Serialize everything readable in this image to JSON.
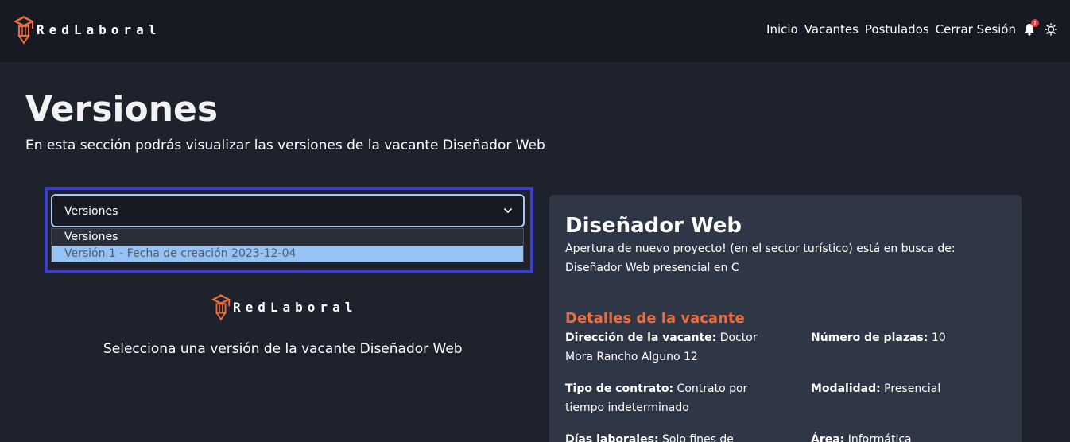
{
  "navbar": {
    "brand": "RedLaboral",
    "links": [
      "Inicio",
      "Vacantes",
      "Postulados",
      "Cerrar Sesión"
    ],
    "notification_badge": "!",
    "icons": {
      "bell": "bell-icon",
      "theme": "sun-icon"
    }
  },
  "page": {
    "title": "Versiones",
    "subtitle": "En esta sección podrás visualizar las versiones de la vacante Diseñador Web"
  },
  "version_select": {
    "selected": "Versiones",
    "options": [
      "Versiones",
      "Versión 1 - Fecha de creación 2023-12-04"
    ],
    "highlighted_index": 1
  },
  "placeholder": {
    "brand": "RedLaboral",
    "message": "Selecciona una versión de la vacante Diseñador Web"
  },
  "vacancy_card": {
    "title": "Diseñador Web",
    "description": "Apertura de nuevo proyecto! (en el sector turístico) está en busca de: Diseñador Web presencial en C",
    "section_title": "Detalles de la vacante",
    "details": [
      {
        "label": "Dirección de la vacante:",
        "value": "Doctor Mora Rancho Alguno 12"
      },
      {
        "label": "Número de plazas:",
        "value": "10"
      },
      {
        "label": "Tipo de contrato:",
        "value": "Contrato por tiempo indeterminado"
      },
      {
        "label": "Modalidad:",
        "value": "Presencial"
      },
      {
        "label": "Días laborales:",
        "value": "Solo fines de"
      },
      {
        "label": "Área:",
        "value": "Informática"
      }
    ]
  },
  "colors": {
    "background": "#1e222c",
    "navbar": "#171a22",
    "card": "#2f3747",
    "accent": "#ee6b3d",
    "focus_ring": "#3b3fc9",
    "highlight": "#96c3f5"
  }
}
